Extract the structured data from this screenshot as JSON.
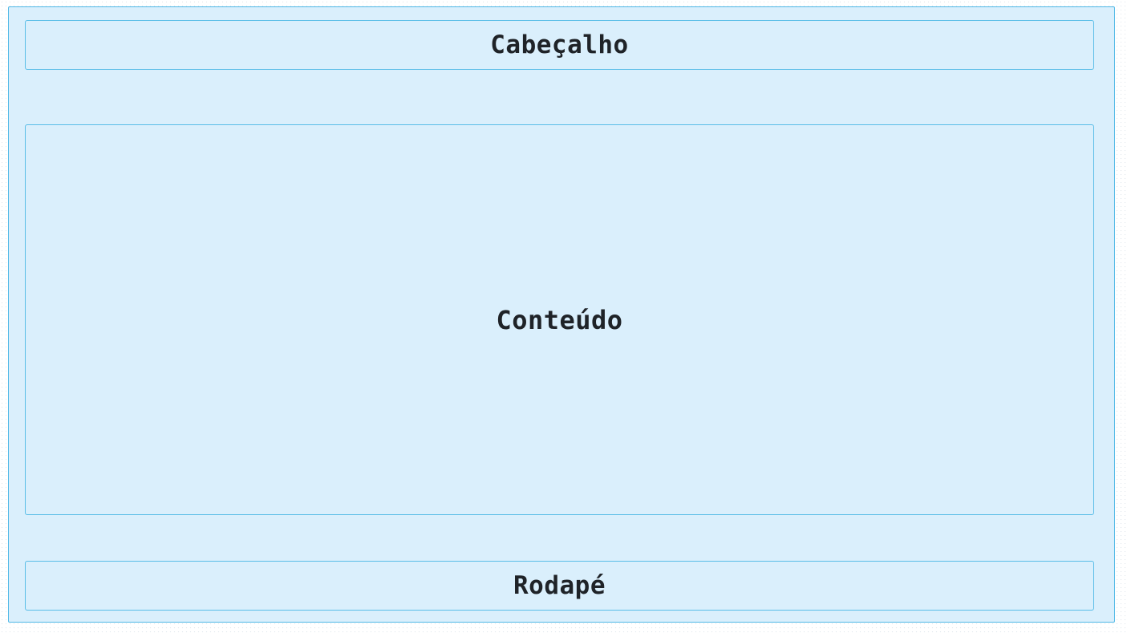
{
  "layout": {
    "header": {
      "label": "Cabeçalho"
    },
    "content": {
      "label": "Conteúdo"
    },
    "footer": {
      "label": "Rodapé"
    }
  },
  "colors": {
    "page_background": "#ffffff",
    "panel_background": "#daeffc",
    "panel_border": "#59bde7",
    "text": "#1f2328"
  }
}
